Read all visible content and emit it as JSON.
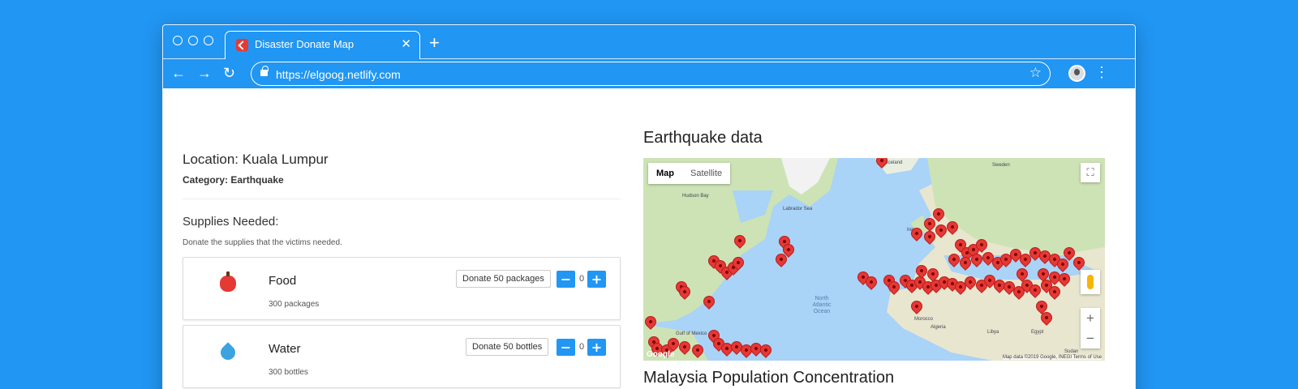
{
  "browser": {
    "tab_title": "Disaster Donate Map",
    "url": "https://elgoog.netlify.com",
    "new_tab_symbol": "+",
    "close_symbol": "✕"
  },
  "details": {
    "location": "Location: Kuala Lumpur",
    "category": "Category: Earthquake"
  },
  "supplies": {
    "title": "Supplies Needed:",
    "subtitle": "Donate the supplies that the victims needed.",
    "items": [
      {
        "name": "Food",
        "quantity": "300 packages",
        "button": "Donate 50 packages",
        "count": "0",
        "icon": "apple-icon"
      },
      {
        "name": "Water",
        "quantity": "300 bottles",
        "button": "Donate 50 bottles",
        "count": "0",
        "icon": "water-drop-icon"
      }
    ]
  },
  "map_section": {
    "title": "Earthquake data",
    "map_button": "Map",
    "satellite_button": "Satellite",
    "attribution": "Map data ©2019 Google, INEGI    Terms of Use",
    "google_logo": "Google",
    "labels": {
      "iceland": "Iceland",
      "sweden": "Sweden",
      "hudson": "Hudson Bay",
      "labrador": "Labrador Sea",
      "ocean": "North Atlantic Ocean",
      "algeria": "Algeria",
      "libya": "Libya",
      "egypt": "Egypt",
      "morocco": "Morocco",
      "gulf": "Gulf of Mexico",
      "ireland": "Irela",
      "sudan": "Sudan"
    }
  },
  "population": {
    "title": "Malaysia Population Concentration"
  },
  "colors": {
    "accent": "#2196f3",
    "pin": "#e53935"
  }
}
